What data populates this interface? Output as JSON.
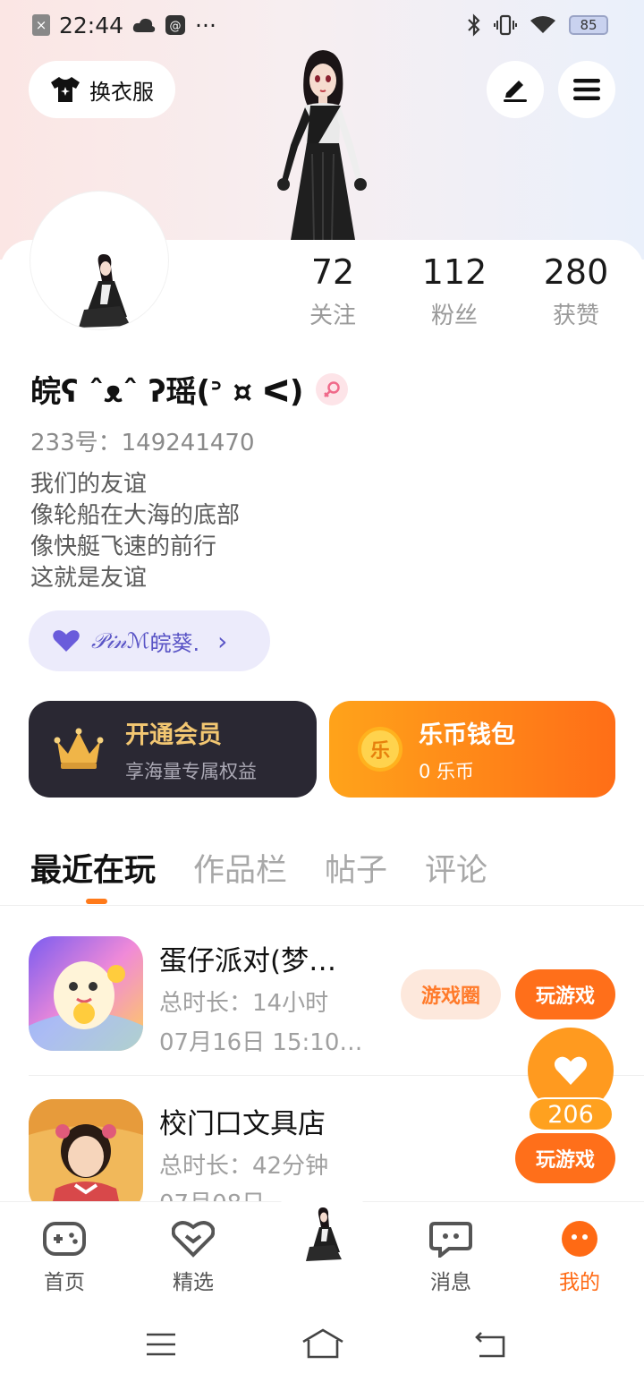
{
  "status_bar": {
    "time": "22:44",
    "battery": "85",
    "dots": "···"
  },
  "header": {
    "outfit_button": "换衣服"
  },
  "stats": [
    {
      "value": "72",
      "label": "关注"
    },
    {
      "value": "112",
      "label": "粉丝"
    },
    {
      "value": "280",
      "label": "获赞"
    }
  ],
  "profile": {
    "name": "皖ʕ ˆᴥˆ ʔ瑶(ᐣ ¤ ᐸ)",
    "uid": "233号：149241470",
    "bio": [
      "我们的友谊",
      "像轮船在大海的底部",
      "像快艇飞速的前行",
      "这就是友谊"
    ],
    "club_script": "𝒫𝒾𝓃ℳ",
    "club_name": "皖葵.",
    "club_arrow": "›"
  },
  "cards": {
    "vip": {
      "title": "开通会员",
      "subtitle": "享海量专属权益"
    },
    "wallet": {
      "title": "乐币钱包",
      "subtitle": "0 乐币",
      "coin_glyph": "乐"
    }
  },
  "tabs": [
    "最近在玩",
    "作品栏",
    "帖子",
    "评论"
  ],
  "games": [
    {
      "title": "蛋仔派对(梦…",
      "duration": "总时长：14小时",
      "last_played": "07月16日 15:10…",
      "circle_label": "游戏圈",
      "play_label": "玩游戏"
    },
    {
      "title": "校门口文具店",
      "duration": "总时长：42分钟",
      "last_played": "07月08日",
      "play_label": "玩游戏"
    }
  ],
  "like": {
    "count": "206"
  },
  "nav": [
    {
      "label": "首页"
    },
    {
      "label": "精选"
    },
    {
      "label": "消息"
    },
    {
      "label": "我的"
    }
  ],
  "colors": {
    "accent": "#ff6f1a",
    "vip_gold": "#f3c772",
    "club_purple": "#5a55c6"
  }
}
